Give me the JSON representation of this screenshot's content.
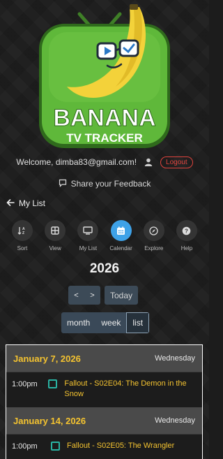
{
  "logo": {
    "line1": "BANANA",
    "line2": "TV TRACKER"
  },
  "account": {
    "welcome": "Welcome, dimba83@gmail.com!",
    "logout_label": "Logout"
  },
  "feedback": {
    "label": "Share your Feedback"
  },
  "breadcrumb": {
    "label": "My List"
  },
  "toolbar": {
    "items": [
      {
        "label": "Sort",
        "icon": "sort-icon"
      },
      {
        "label": "View",
        "icon": "grid-icon"
      },
      {
        "label": "My List",
        "icon": "tv-icon"
      },
      {
        "label": "Calendar",
        "icon": "calendar-icon"
      },
      {
        "label": "Explore",
        "icon": "compass-icon"
      },
      {
        "label": "Help",
        "icon": "help-icon"
      }
    ],
    "active": "Calendar"
  },
  "calendar": {
    "year": "2026",
    "prev_label": "<",
    "next_label": ">",
    "today_label": "Today",
    "views": [
      "month",
      "week",
      "list"
    ],
    "selected_view": "list",
    "days": [
      {
        "date": "January 7, 2026",
        "weekday": "Wednesday",
        "events": [
          {
            "time": "1:00pm",
            "title": "Fallout - S02E04: The Demon in the Snow"
          }
        ]
      },
      {
        "date": "January 14, 2026",
        "weekday": "Wednesday",
        "events": [
          {
            "time": "1:00pm",
            "title": "Fallout - S02E05: The Wrangler"
          }
        ]
      }
    ]
  },
  "colors": {
    "accent_yellow": "#f4c330",
    "active_blue": "#3ea2e8",
    "logout_red": "#e0443e",
    "tv_green": "#5fb83a",
    "event_teal": "#29b3a3"
  }
}
